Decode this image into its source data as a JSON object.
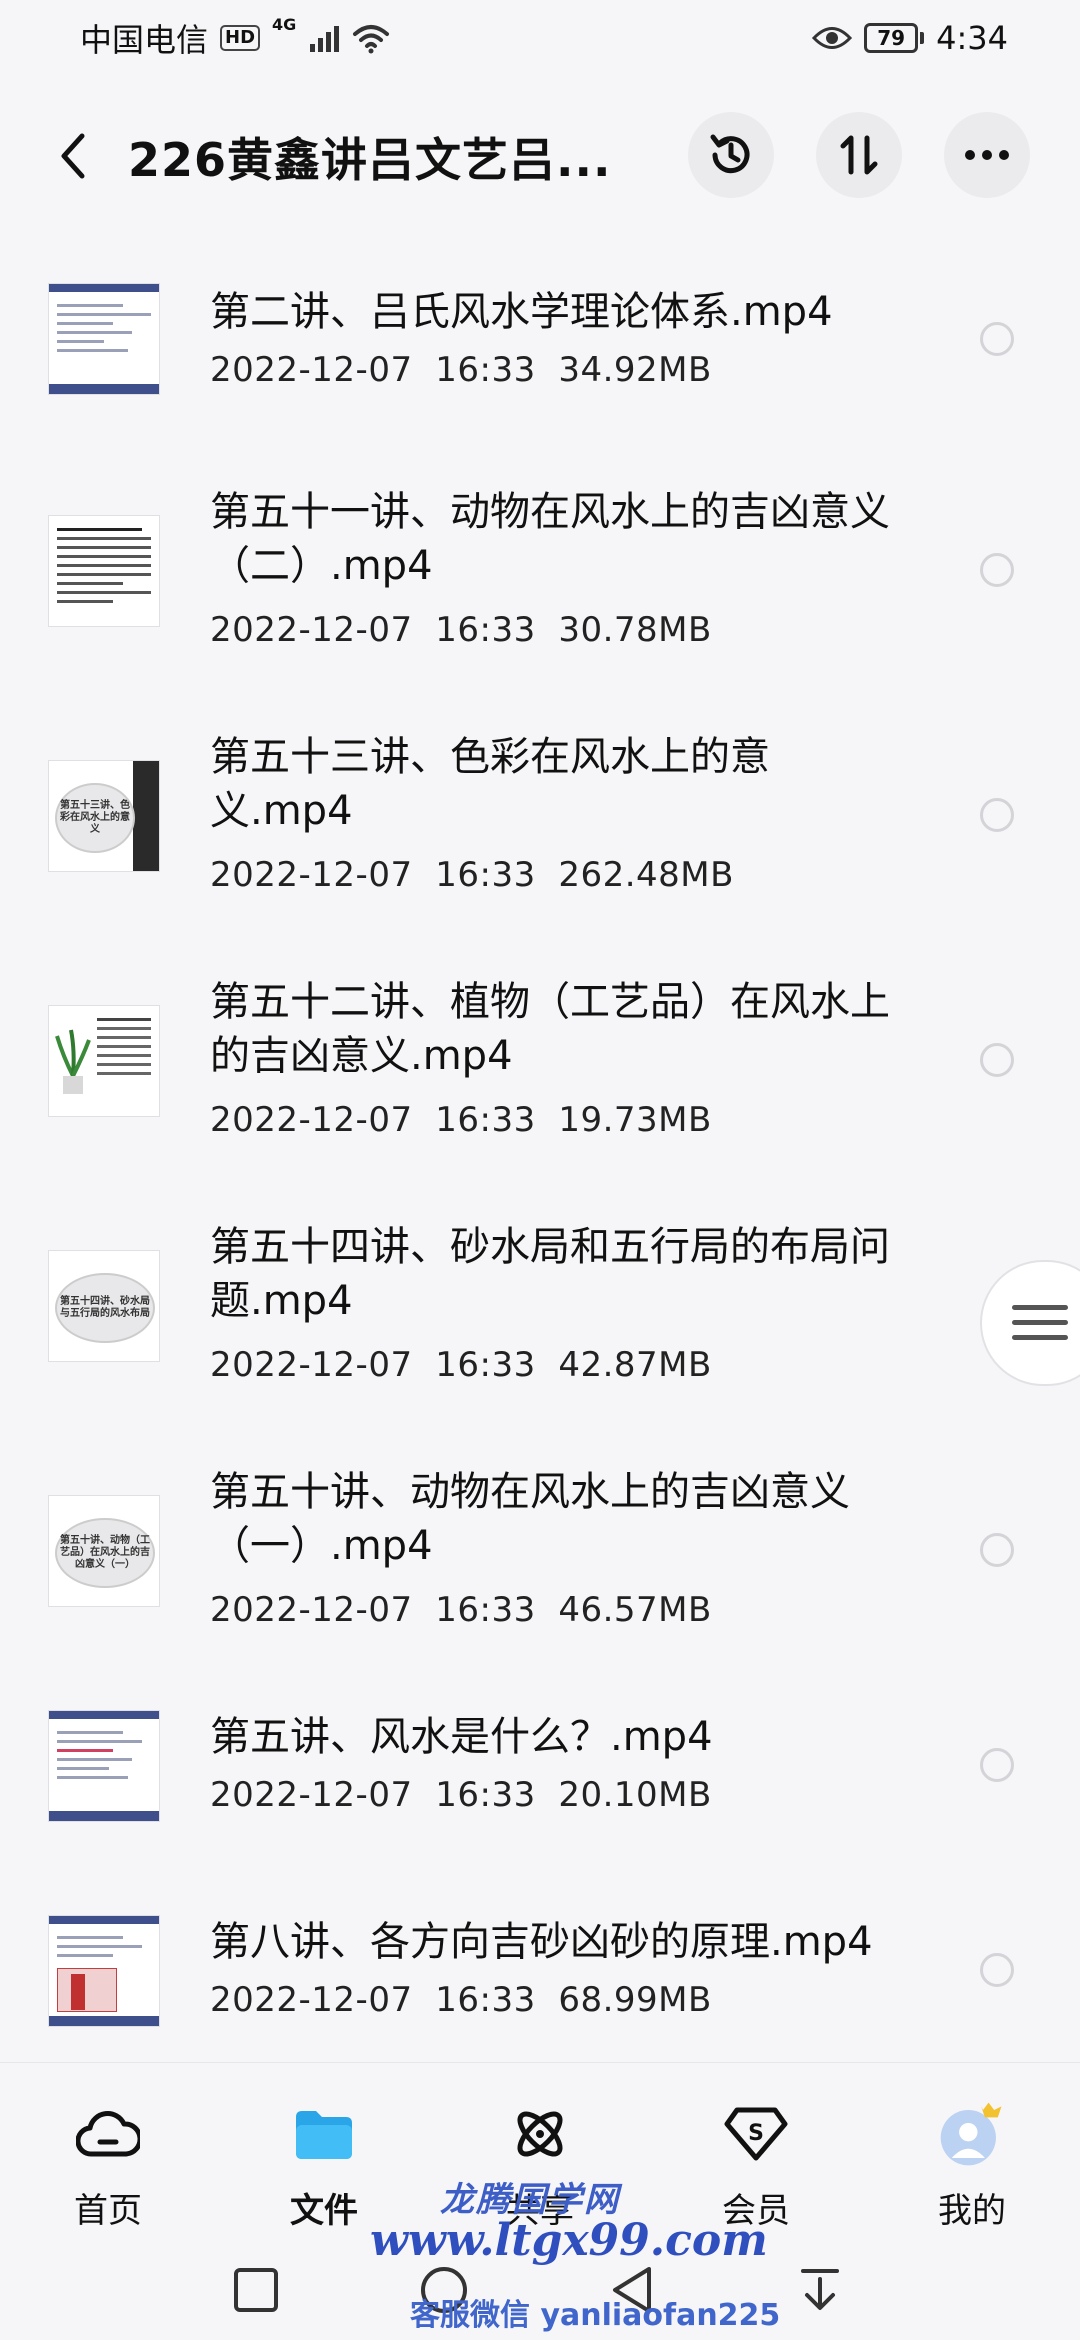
{
  "status_bar": {
    "carrier": "中国电信",
    "hd": "HD",
    "network": "4G",
    "battery": "79",
    "time": "4:34"
  },
  "header": {
    "title": "226黄鑫讲吕文艺吕...",
    "icons": [
      "back-arrow-icon",
      "history-icon",
      "sort-icon",
      "more-icon"
    ]
  },
  "files": [
    {
      "name": "第二讲、吕氏风水学理论体系.mp4",
      "date": "2022-12-07",
      "time": "16:33",
      "size": "34.92MB",
      "thumb": "doc"
    },
    {
      "name": "第五十一讲、动物在风水上的吉凶意义（二）.mp4",
      "date": "2022-12-07",
      "time": "16:33",
      "size": "30.78MB",
      "thumb": "text"
    },
    {
      "name": "第五十三讲、色彩在风水上的意义.mp4",
      "date": "2022-12-07",
      "time": "16:33",
      "size": "262.48MB",
      "thumb": "circle",
      "thumb_text": "第五十三讲、色彩在风水上的意义"
    },
    {
      "name": "第五十二讲、植物（工艺品）在风水上的吉凶意义.mp4",
      "date": "2022-12-07",
      "time": "16:33",
      "size": "19.73MB",
      "thumb": "plant"
    },
    {
      "name": "第五十四讲、砂水局和五行局的布局问题.mp4",
      "date": "2022-12-07",
      "time": "16:33",
      "size": "42.87MB",
      "thumb": "circle",
      "thumb_text": "第五十四讲、砂水局与五行局的风水布局"
    },
    {
      "name": "第五十讲、动物在风水上的吉凶意义（一）.mp4",
      "date": "2022-12-07",
      "time": "16:33",
      "size": "46.57MB",
      "thumb": "circle",
      "thumb_text": "第五十讲、动物（工艺品）在风水上的吉凶意义（一）"
    },
    {
      "name": "第五讲、风水是什么？.mp4",
      "date": "2022-12-07",
      "time": "16:33",
      "size": "20.10MB",
      "thumb": "doc"
    },
    {
      "name": "第八讲、各方向吉砂凶砂的原理.mp4",
      "date": "2022-12-07",
      "time": "16:33",
      "size": "68.99MB",
      "thumb": "doc2"
    }
  ],
  "bottom_nav": [
    {
      "label": "首页",
      "icon": "cloud-icon",
      "active": false
    },
    {
      "label": "文件",
      "icon": "folder-icon",
      "active": true
    },
    {
      "label": "共享",
      "icon": "share-atom-icon",
      "active": false
    },
    {
      "label": "会员",
      "icon": "vip-icon",
      "active": false
    },
    {
      "label": "我的",
      "icon": "avatar-icon",
      "active": false
    }
  ],
  "watermark": {
    "line1": "龙腾国学网",
    "line2": "www.ltgx99.com",
    "line3": "客服微信 yanliaofan225"
  },
  "colors": {
    "background": "#f6f6f8",
    "folder_blue": "#2aa6e8",
    "watermark_blue": "#2f4fbf"
  }
}
